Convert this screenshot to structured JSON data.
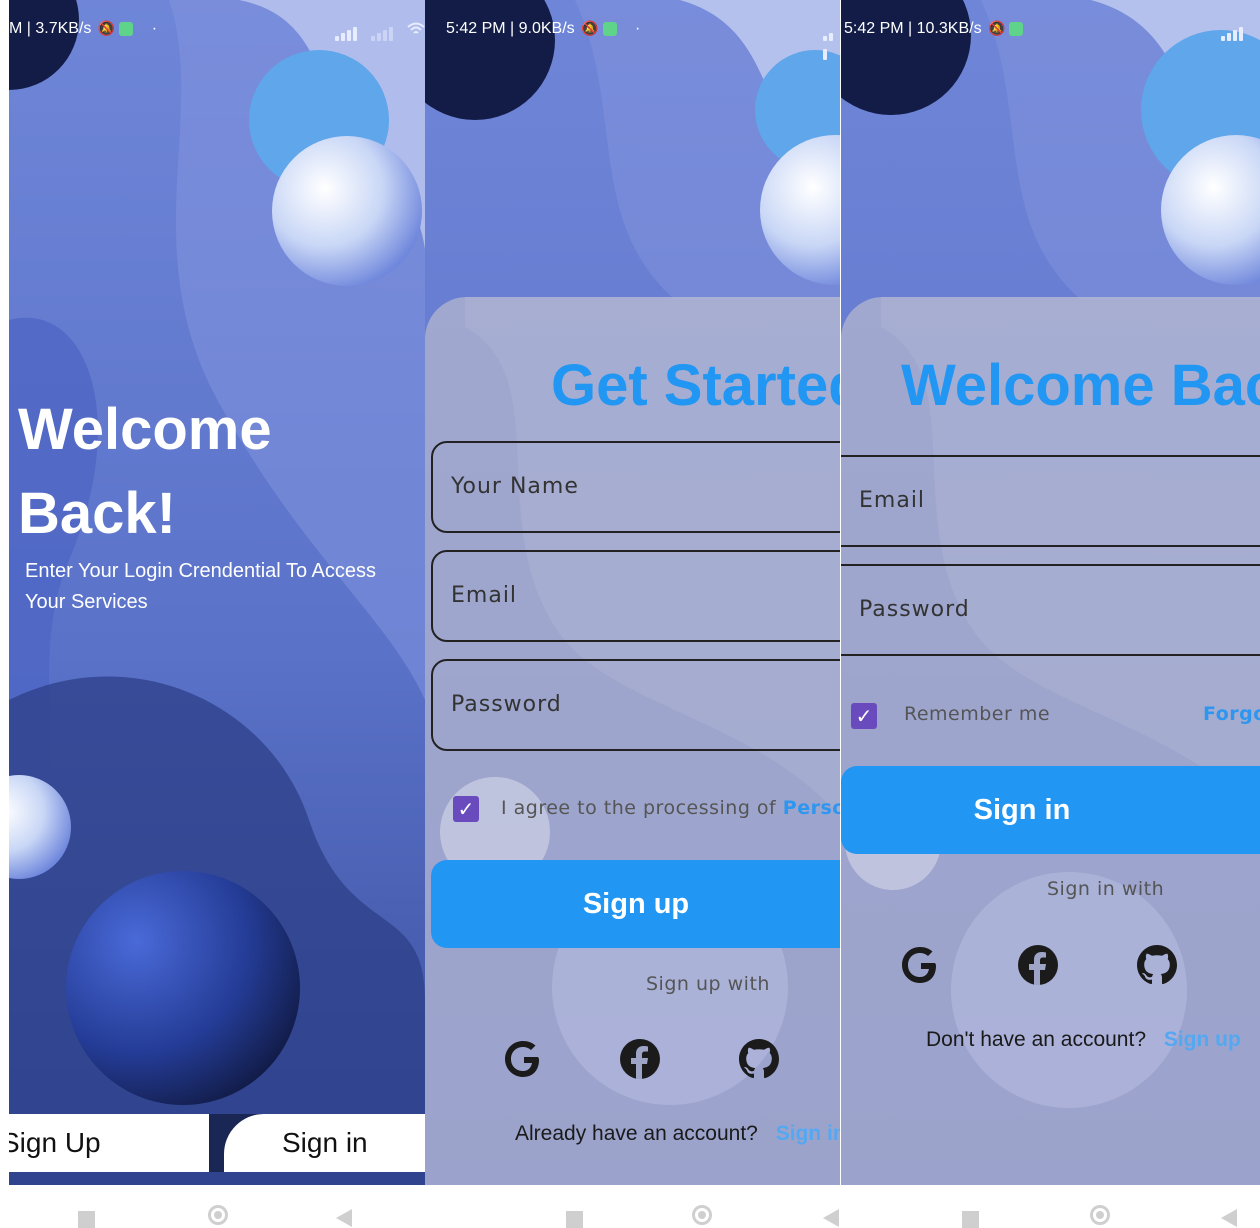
{
  "screen1": {
    "status_text": "M | 3.7KB/s",
    "title_line1": "Welcome",
    "title_line2": "Back!",
    "subtitle": "Enter Your Login Crendential To Access Your Services",
    "signup_label": "Sign Up",
    "signin_label": "Sign in"
  },
  "screen2": {
    "status_text": "5:42 PM | 9.0KB/s",
    "heading": "Get Started",
    "name_placeholder": "Your Name",
    "email_placeholder": "Email",
    "password_placeholder": "Password",
    "agree_text": "I agree to the processing of ",
    "agree_link": "Personal data",
    "signup_button": "Sign up",
    "social_label": "Sign up with",
    "already_text": "Already have an account?",
    "signin_link": "Sign in"
  },
  "screen3": {
    "status_text": "5:42 PM | 10.3KB/s",
    "heading": "Welcome Back",
    "email_placeholder": "Email",
    "password_placeholder": "Password",
    "remember_text": "Remember me",
    "forgot_link": "Forgot Password?",
    "signin_button": "Sign in",
    "social_label": "Sign in with",
    "no_account_text": "Don't have an account?",
    "signup_link": "Sign up"
  },
  "colors": {
    "accent": "#2196f3",
    "checkbox": "#6a4bbd",
    "background_blue": "#6b7fd2"
  },
  "icons": [
    "google-icon",
    "facebook-icon",
    "github-icon",
    "square-nav-icon",
    "home-nav-icon",
    "back-nav-icon"
  ]
}
